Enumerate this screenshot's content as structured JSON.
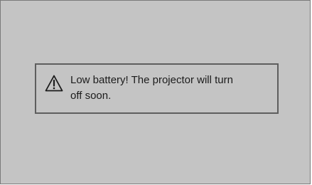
{
  "screen": {
    "background_color": "#c4c4c4"
  },
  "dialog": {
    "icon": "warning-triangle-icon",
    "message": "Low battery! The projector will turn off soon."
  }
}
